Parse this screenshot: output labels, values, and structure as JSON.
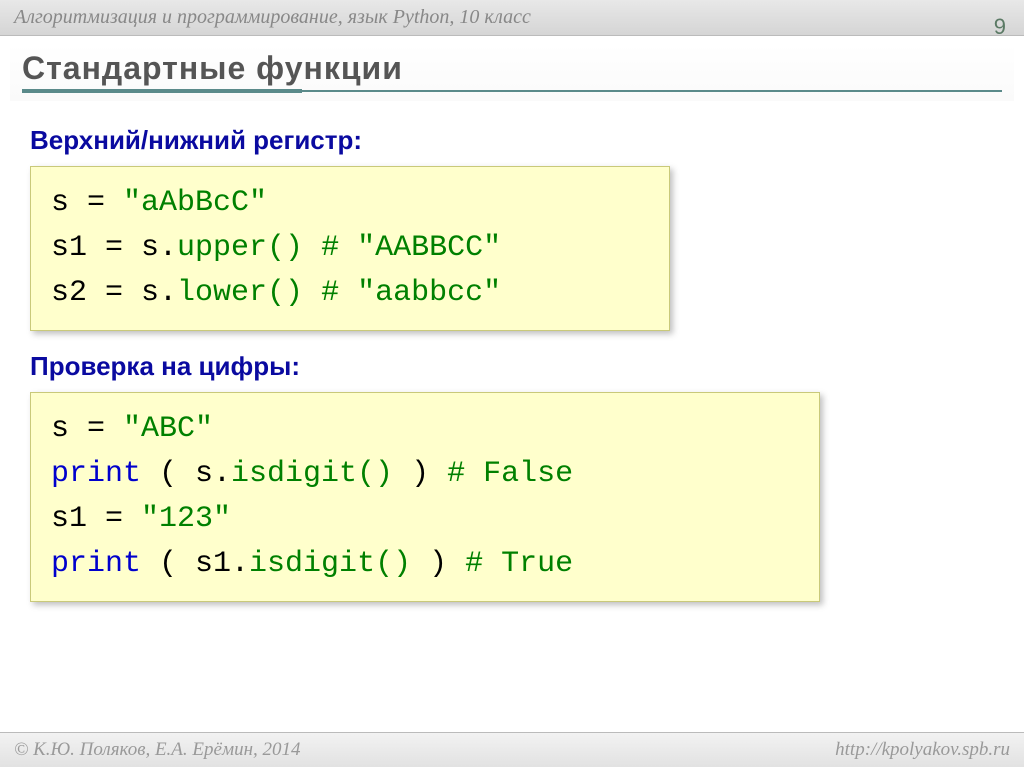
{
  "header": "Алгоритмизация и программирование, язык Python, 10 класс",
  "page_number": "9",
  "title": "Стандартные функции",
  "sub1": "Верхний/нижний регистр:",
  "code1": {
    "l1a": "s = ",
    "l1b": "\"aAbBcC\"",
    "l2a": "s1 = s.",
    "l2b": "upper()",
    "l2c": "   # \"AABBCC\"",
    "l3a": "s2 = s.",
    "l3b": "lower()",
    "l3c": "   # \"aabbcc\""
  },
  "sub2": "Проверка на цифры:",
  "code2": {
    "l1a": "s = ",
    "l1b": "\"ABC\"",
    "l2a": "print",
    "l2b": " ( s.",
    "l2c": "isdigit()",
    "l2d": " )   ",
    "l2e": "# False",
    "l3a": "s1 = ",
    "l3b": "\"123\"",
    "l4a": "print",
    "l4b": " ( s1.",
    "l4c": "isdigit()",
    "l4d": " )  ",
    "l4e": "# True"
  },
  "footer_left": "© К.Ю. Поляков, Е.А. Ерёмин, 2014",
  "footer_right": "http://kpolyakov.spb.ru"
}
